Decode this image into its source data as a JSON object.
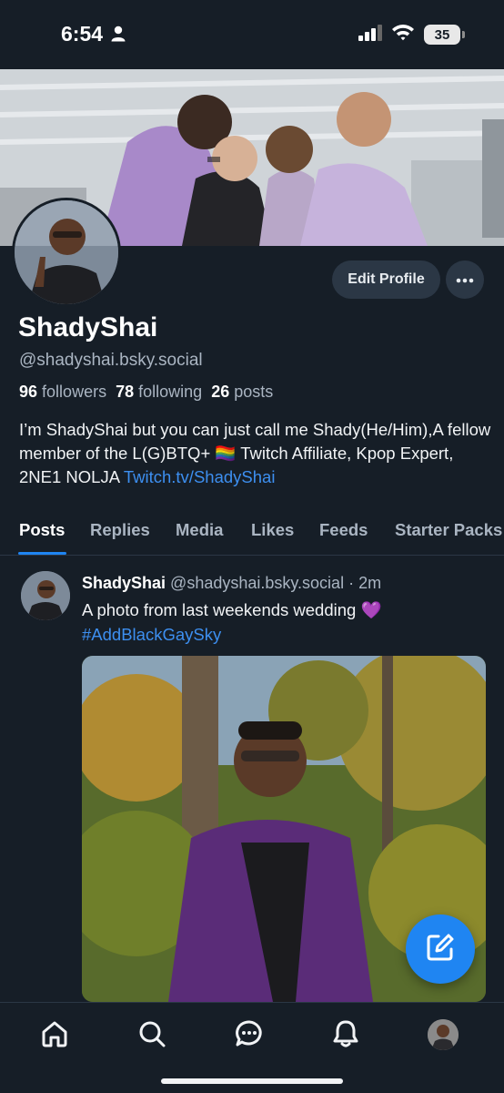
{
  "status_bar": {
    "time": "6:54",
    "battery": "35"
  },
  "profile": {
    "display_name": "ShadyShai",
    "handle": "@shadyshai.bsky.social",
    "followers_count": "96",
    "followers_label": "followers",
    "following_count": "78",
    "following_label": "following",
    "posts_count": "26",
    "posts_label": "posts",
    "bio_text": "I’m ShadyShai but you can just call me Shady(He/Him),A fellow member of the L(G)BTQ+ 🏳️‍🌈 Twitch Affiliate, Kpop Expert, 2NE1 NOLJA ",
    "bio_link": "Twitch.tv/ShadyShai",
    "edit_button_label": "Edit Profile"
  },
  "tabs": [
    {
      "label": "Posts",
      "active": true
    },
    {
      "label": "Replies",
      "active": false
    },
    {
      "label": "Media",
      "active": false
    },
    {
      "label": "Likes",
      "active": false
    },
    {
      "label": "Feeds",
      "active": false
    },
    {
      "label": "Starter Packs",
      "active": false
    }
  ],
  "post": {
    "author": "ShadyShai",
    "handle": "@shadyshai.bsky.social",
    "separator": "·",
    "time": "2m",
    "text": "A photo from last weekends wedding 💜",
    "hashtag": "#AddBlackGaySky"
  },
  "bottom_nav": [
    {
      "icon": "home-icon"
    },
    {
      "icon": "search-icon"
    },
    {
      "icon": "chat-icon"
    },
    {
      "icon": "bell-icon"
    },
    {
      "icon": "avatar"
    }
  ],
  "colors": {
    "background": "#161e27",
    "accent": "#1f85f2",
    "link": "#3d8ff0",
    "muted_text": "#aab5c2",
    "button_bg": "#2b3745"
  }
}
